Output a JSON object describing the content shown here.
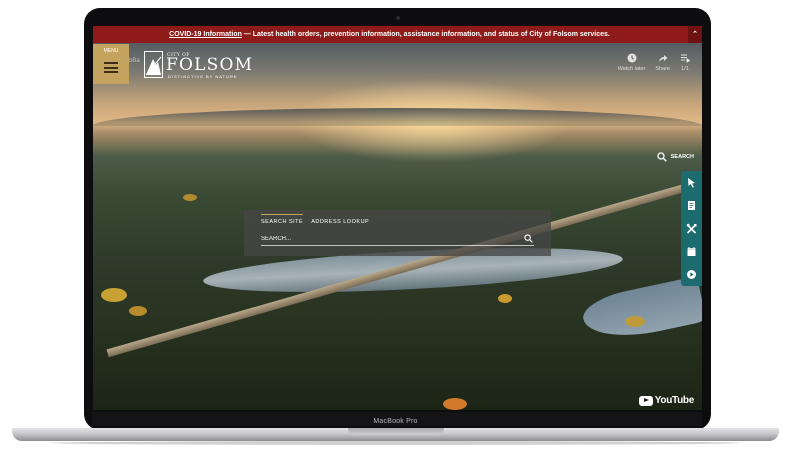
{
  "banner": {
    "link_text": "COVID-19 Information",
    "text": " — Latest health orders, prevention information, assistance information, and status of City of Folsom services.",
    "toggle_icon": "chevron-up-icon"
  },
  "header": {
    "menu_label": "MENU",
    "overlay_text": "bBa",
    "logo": {
      "small": "CITY OF",
      "name": "FOLSOM",
      "tagline": "DISTINCTIVE BY NATURE"
    }
  },
  "youtube": {
    "watch_later": "Watch later",
    "share": "Share",
    "playlist": "1/1",
    "brand": "YouTube"
  },
  "search": {
    "toggle_label": "SEARCH",
    "tabs": [
      {
        "label": "SEARCH SITE",
        "active": true
      },
      {
        "label": "ADDRESS LOOKUP",
        "active": false
      }
    ],
    "placeholder": "SEARCH..."
  },
  "quick_links": [
    {
      "icon": "cursor-icon"
    },
    {
      "icon": "document-icon"
    },
    {
      "icon": "tools-icon"
    },
    {
      "icon": "calendar-icon"
    },
    {
      "icon": "play-icon"
    }
  ],
  "device": {
    "label": "MacBook Pro"
  },
  "colors": {
    "banner": "#8e1b1a",
    "menu": "#c4a35e",
    "quick_links": "#1b6b6f"
  }
}
